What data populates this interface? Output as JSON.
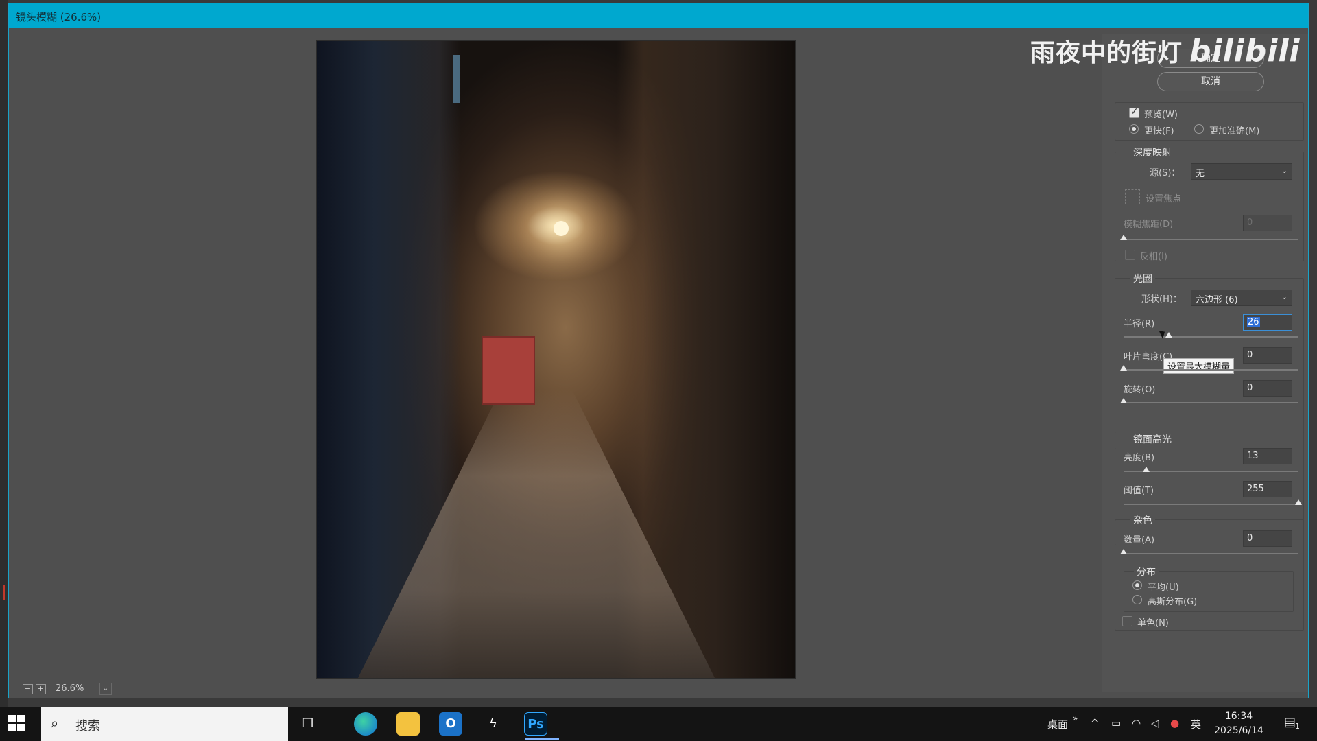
{
  "window": {
    "title": "镜头模糊 (26.6%)"
  },
  "watermark": {
    "text": "雨夜中的街灯",
    "logo": "bilibili"
  },
  "zoom": {
    "out_label": "−",
    "in_label": "+",
    "value": "26.6%",
    "dropdown": "⌄"
  },
  "buttons": {
    "ok": "确定",
    "cancel": "取消"
  },
  "preview": {
    "checkbox_label": "预览(W)",
    "faster_label": "更快(F)",
    "accurate_label": "更加准确(M)"
  },
  "depth_map": {
    "title": "深度映射",
    "source_label": "源(S)：",
    "source_value": "无",
    "focus_label": "设置焦点",
    "blur_focal_label": "模糊焦距(D)",
    "blur_focal_value": "0",
    "invert_label": "反相(I)"
  },
  "iris": {
    "title": "光圈",
    "shape_label": "形状(H)：",
    "shape_value": "六边形 (6)",
    "radius_label": "半径(R)",
    "radius_value": "26",
    "curvature_label": "叶片弯度(C)",
    "curvature_value": "0",
    "rotation_label": "旋转(O)",
    "rotation_value": "0",
    "tooltip": "设置最大模糊量"
  },
  "specular": {
    "title": "镜面高光",
    "brightness_label": "亮度(B)",
    "brightness_value": "13",
    "threshold_label": "阈值(T)",
    "threshold_value": "255"
  },
  "noise": {
    "title": "杂色",
    "amount_label": "数量(A)",
    "amount_value": "0",
    "distribution_title": "分布",
    "uniform_label": "平均(U)",
    "gaussian_label": "高斯分布(G)",
    "mono_label": "单色(N)"
  },
  "sliders": {
    "blur_focal": 0,
    "radius": 26,
    "curvature": 0,
    "rotation": 0,
    "brightness": 13,
    "threshold": 255,
    "amount": 0
  },
  "taskbar": {
    "search_placeholder": "搜索",
    "desktop_label": "桌面",
    "ime_label": "英",
    "time": "16:34",
    "date": "2025/6/14",
    "notify_count": "1",
    "ps_label": "Ps"
  }
}
